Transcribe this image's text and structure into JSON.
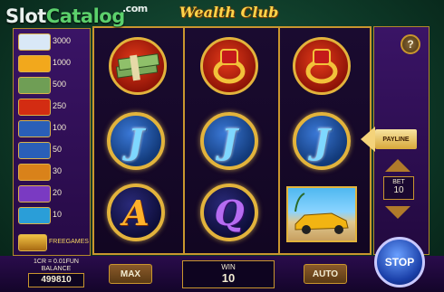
{
  "watermark": {
    "part1": "Slot",
    "part2": "Catalog",
    "suffix": ".com"
  },
  "game": {
    "title": "Wealth Club"
  },
  "paytable": {
    "rows": [
      {
        "symbol": "jet-icon",
        "value": "3000",
        "color": "#d9e8f7"
      },
      {
        "symbol": "car-icon",
        "value": "1000",
        "color": "#f2a81c"
      },
      {
        "symbol": "money-stack-icon",
        "value": "500",
        "color": "#6f9e55"
      },
      {
        "symbol": "ring-icon",
        "value": "250",
        "color": "#d32c12"
      },
      {
        "symbol": "j-coin-icon",
        "value": "100",
        "color": "#2a5fb8"
      },
      {
        "symbol": "k-coin-icon",
        "value": "50",
        "color": "#2a5fb8"
      },
      {
        "symbol": "a-coin-icon",
        "value": "30",
        "color": "#d9821a"
      },
      {
        "symbol": "q-coin-icon",
        "value": "20",
        "color": "#7a3ac2"
      },
      {
        "symbol": "10-coin-icon",
        "value": "10",
        "color": "#2a9ed8"
      }
    ],
    "bonus": {
      "symbol": "treasure-chest-icon",
      "label": "FREEGAMES"
    }
  },
  "reels": [
    [
      "money-stack",
      "J",
      "A"
    ],
    [
      "ring",
      "J",
      "Q"
    ],
    [
      "ring",
      "J",
      "car"
    ]
  ],
  "controls": {
    "help": "?",
    "payline": "PAYLINE",
    "bet_label": "BET",
    "bet_value": "10",
    "max": "MAX",
    "auto": "AUTO",
    "stop": "STOP"
  },
  "footer": {
    "credit_rate": "1CR = 0.01FUN",
    "balance_label": "BALANCE",
    "balance_value": "499810",
    "win_label": "WIN",
    "win_value": "10"
  }
}
